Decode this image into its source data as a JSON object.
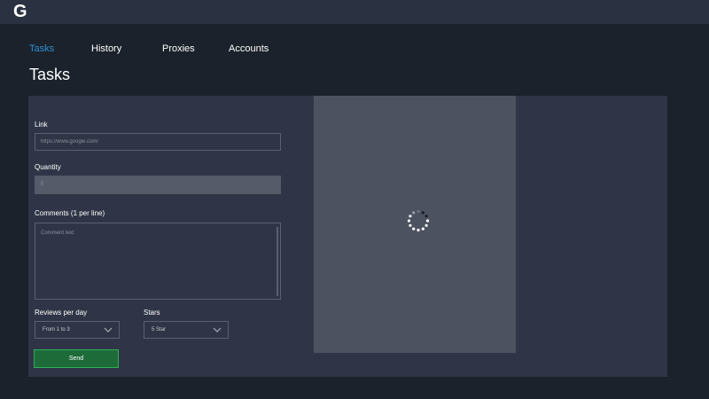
{
  "app": {
    "logo": "G"
  },
  "nav": {
    "items": [
      {
        "label": "Tasks",
        "active": true
      },
      {
        "label": "History",
        "active": false
      },
      {
        "label": "Proxies",
        "active": false
      },
      {
        "label": "Accounts",
        "active": false
      }
    ]
  },
  "page": {
    "title": "Tasks"
  },
  "form": {
    "link": {
      "label": "Link",
      "placeholder": "https://www.google.com/"
    },
    "quantity": {
      "label": "Quantity",
      "value": "5"
    },
    "comments": {
      "label": "Comments (1 per line)",
      "placeholder": "Comment text"
    },
    "reviews_per_day": {
      "label": "Reviews per day",
      "selected": "From 1 to 3"
    },
    "stars": {
      "label": "Stars",
      "selected": "5 Star"
    },
    "send_label": "Send"
  },
  "preview": {
    "icon": "loading-spinner-icon"
  },
  "colors": {
    "accent": "#2e8fd6",
    "send_bg": "#1e6b3a",
    "send_border": "#2fae55",
    "background": "#1b222b",
    "panel": "#2f3546"
  }
}
